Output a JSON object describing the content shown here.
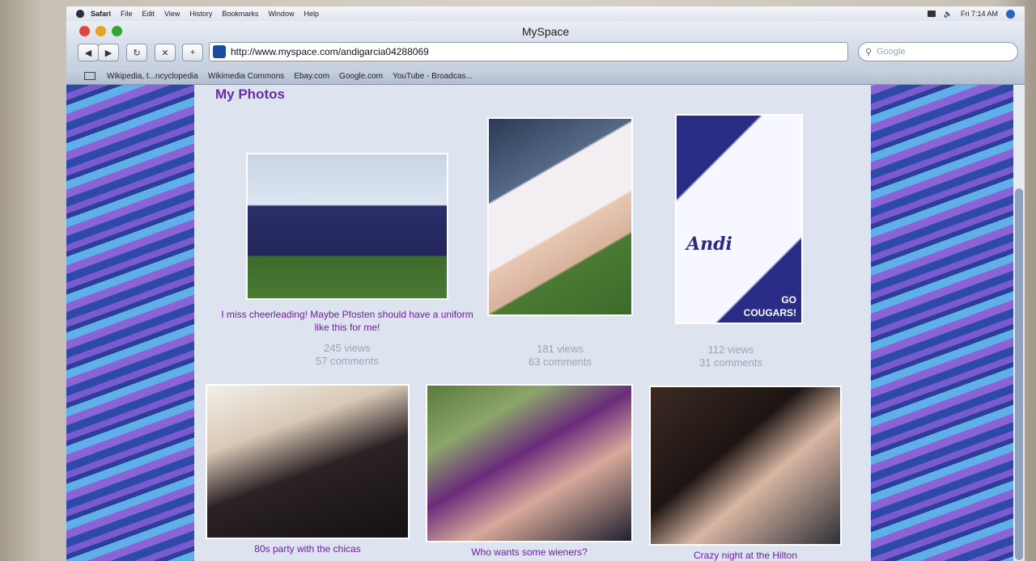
{
  "menubar": {
    "app": "Safari",
    "items": [
      "File",
      "Edit",
      "View",
      "History",
      "Bookmarks",
      "Window",
      "Help"
    ],
    "clock": "Fri 7:14 AM"
  },
  "window": {
    "title": "MySpace",
    "url": "http://www.myspace.com/andigarcia04288069",
    "search_placeholder": "Google"
  },
  "bookmarks": [
    "Wikipedia, t...ncyclopedia",
    "Wikimedia Commons",
    "Ebay.com",
    "Google.com",
    "YouTube - Broadcas..."
  ],
  "page": {
    "section_title": "My Photos",
    "photos": [
      {
        "caption": "I miss cheerleading! Maybe Pfosten should have a uniform like this for me!",
        "views": "245 views",
        "comments": "57 comments"
      },
      {
        "caption": "",
        "views": "181 views",
        "comments": "63 comments"
      },
      {
        "caption": "",
        "views": "112 views",
        "comments": "31 comments",
        "overlay_name": "Andi",
        "overlay_go": "GO",
        "overlay_team": "COUGARS!"
      },
      {
        "caption": "80s party with the chicas"
      },
      {
        "caption": "Who wants some wieners?"
      },
      {
        "caption": "Crazy night at the Hilton"
      }
    ]
  },
  "colors": {
    "accent": "#6a1fa5",
    "panel": "#dde4f0"
  },
  "icons": [
    "apple-icon",
    "back-icon",
    "forward-icon",
    "reload-icon",
    "stop-icon",
    "add-bookmark-icon",
    "search-icon",
    "bookmarks-book-icon"
  ]
}
